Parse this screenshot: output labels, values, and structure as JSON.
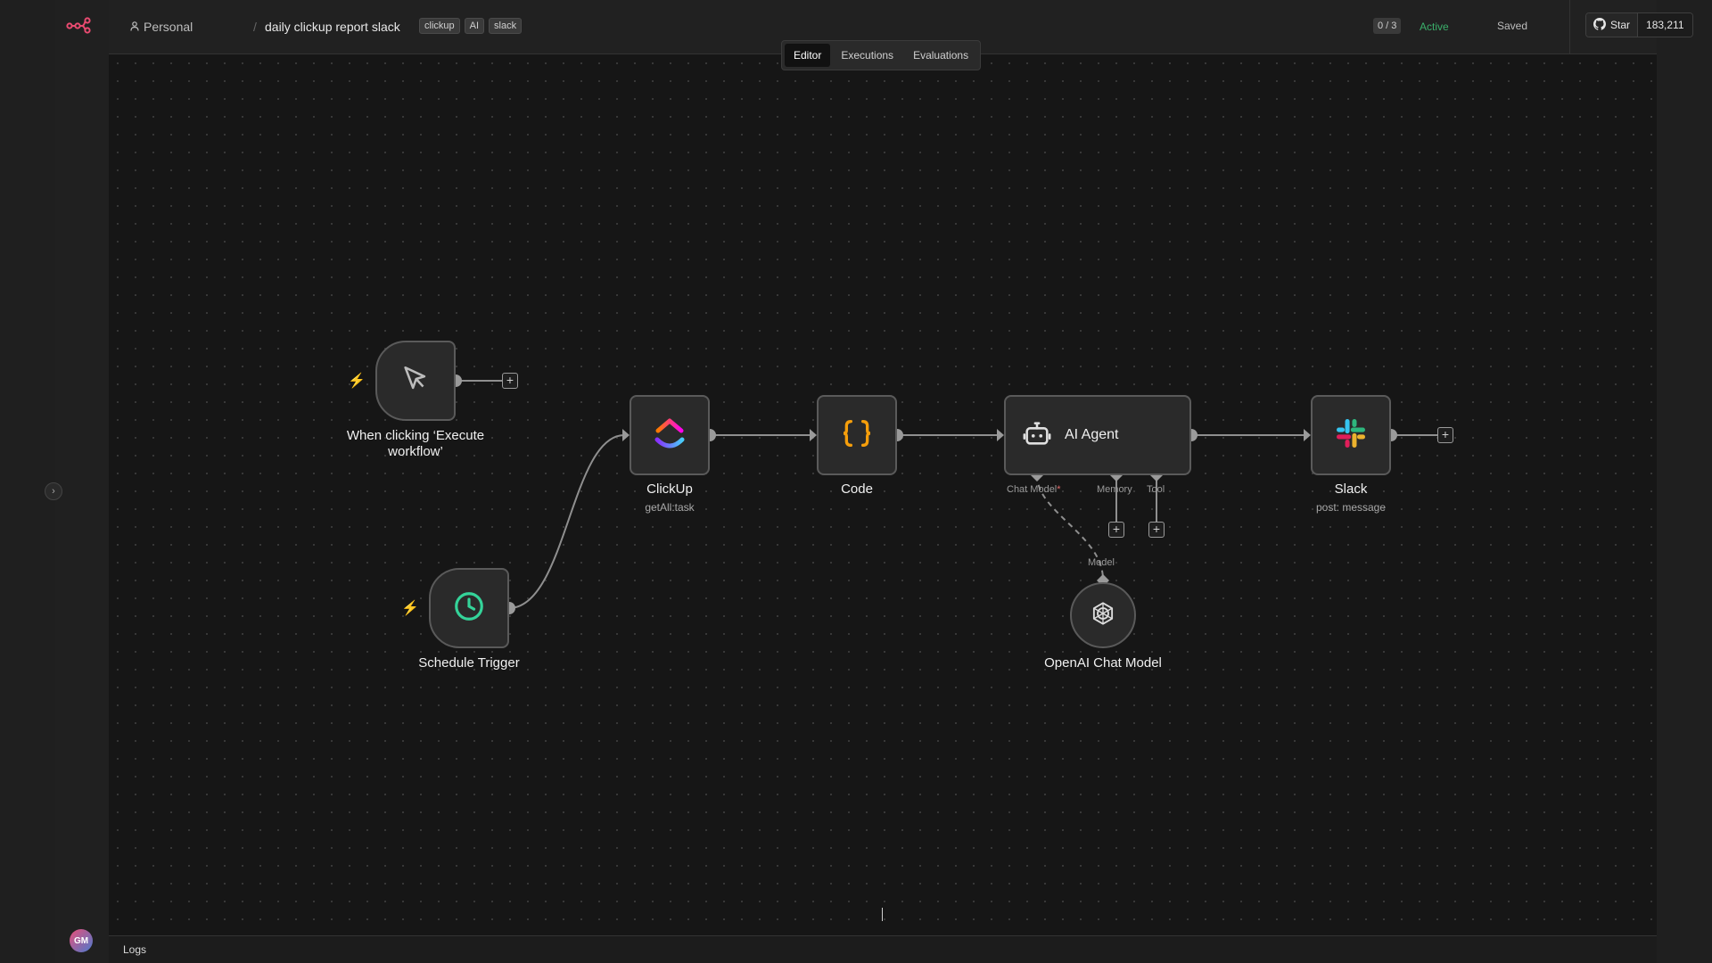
{
  "breadcrumb": {
    "owner": "Personal",
    "separator": "/",
    "workflow_title": "daily clickup report slack",
    "tags": [
      "clickup",
      "AI",
      "slack"
    ]
  },
  "tabs": [
    {
      "label": "Editor",
      "active": true
    },
    {
      "label": "Executions",
      "active": false
    },
    {
      "label": "Evaluations",
      "active": false
    }
  ],
  "status": {
    "counter": "0 / 3",
    "active_label": "Active",
    "saved_label": "Saved"
  },
  "github": {
    "star_label": "Star",
    "star_count": "183,211"
  },
  "user": {
    "initials": "GM"
  },
  "logs": {
    "label": "Logs"
  },
  "nodes": {
    "manual_trigger": {
      "label": "When clicking ‘Execute workflow’"
    },
    "schedule_trigger": {
      "label": "Schedule Trigger"
    },
    "clickup": {
      "label": "ClickUp",
      "subtitle": "getAll:task"
    },
    "code": {
      "label": "Code"
    },
    "ai_agent": {
      "label": "AI Agent",
      "ports": {
        "chat_model": "Chat Model",
        "required_mark": "*",
        "memory": "Memory",
        "tool": "Tool"
      }
    },
    "slack": {
      "label": "Slack",
      "subtitle": "post: message"
    },
    "openai_chat_model": {
      "label": "OpenAI Chat Model",
      "port": "Model"
    }
  },
  "colors": {
    "accent_active": "#3bb06b",
    "trigger_bolt": "#ef5a4a",
    "code_braces": "#f59e0b",
    "schedule_clock": "#34d399"
  },
  "icons": {
    "logo": "n8n-logo-icon",
    "manual": "pointer-icon",
    "schedule": "clock-icon",
    "clickup": "clickup-icon",
    "code": "braces-icon",
    "agent": "robot-icon",
    "slack": "slack-icon",
    "openai": "openai-icon",
    "github": "github-icon",
    "user": "person-icon"
  }
}
